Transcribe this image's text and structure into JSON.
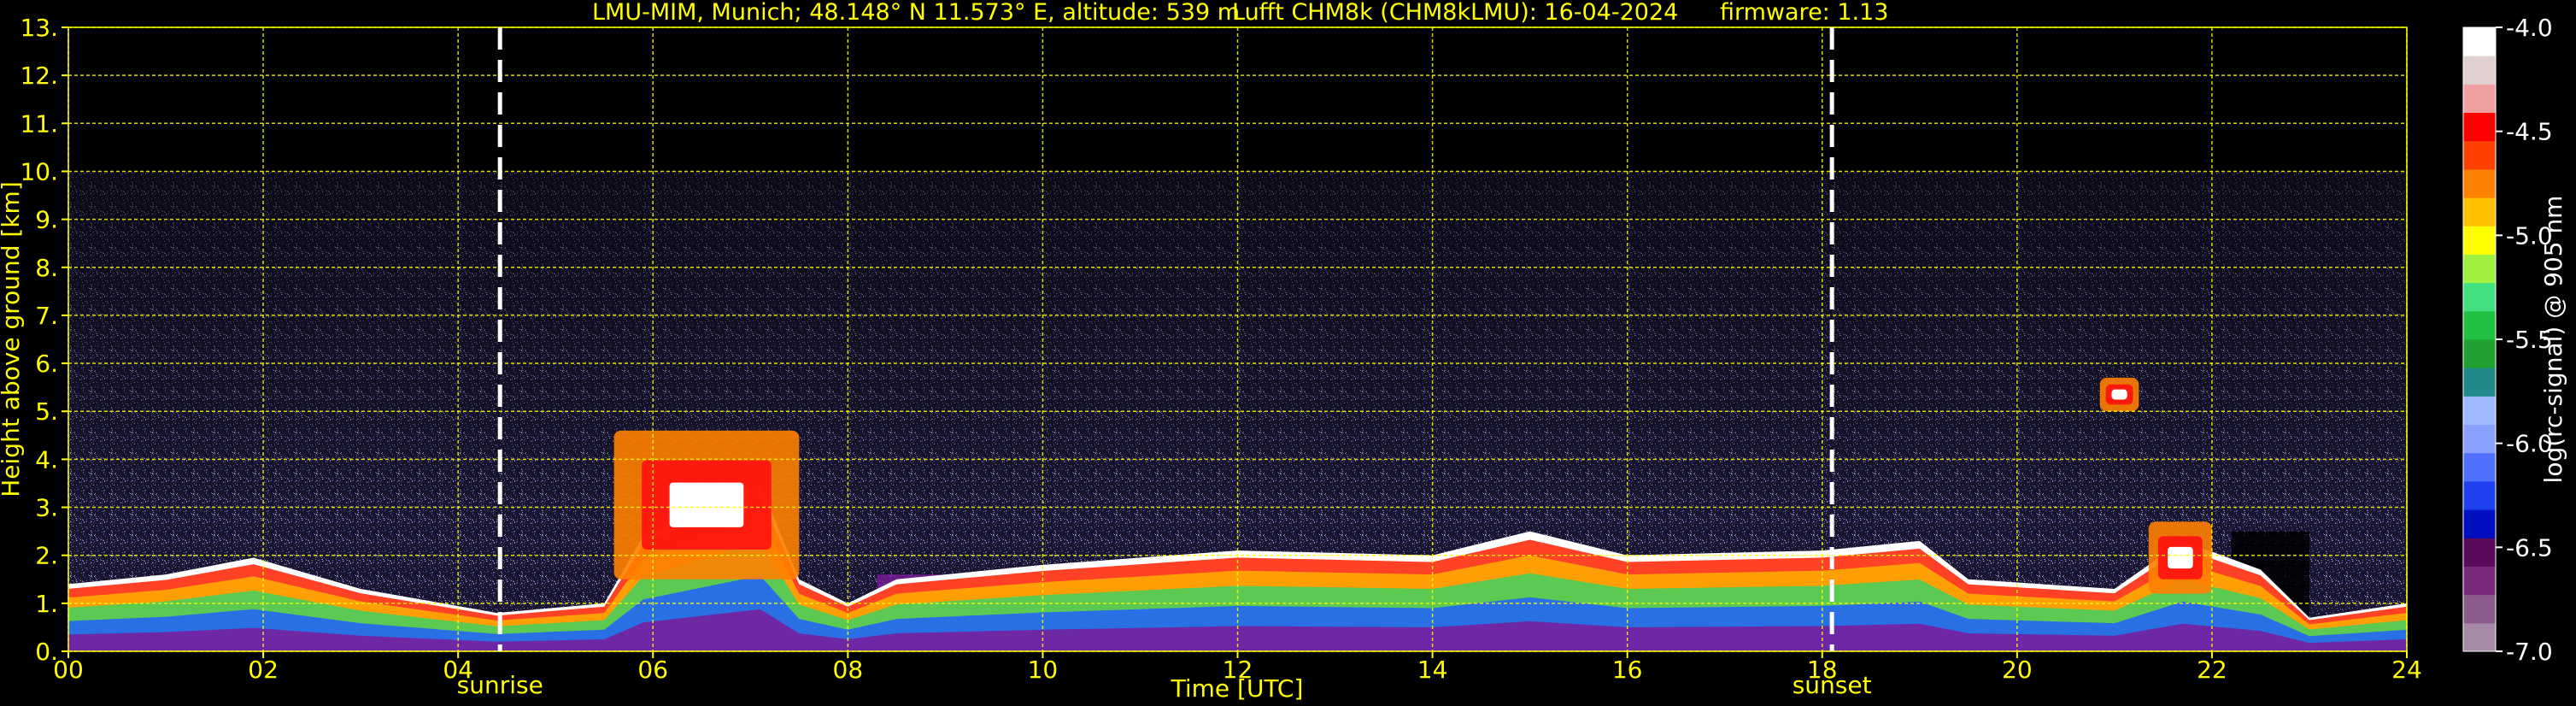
{
  "title": {
    "location": "LMU-MIM, Munich; 48.148° N 11.573° E, altitude: 539 m",
    "instrument": "Lufft CHM8k (CHM8kLMU): 16-04-2024",
    "firmware": "firmware: 1.13"
  },
  "colors": {
    "text": "#ffff00",
    "grid": "#ffff00",
    "background": "#000000",
    "markers": "#ffffff"
  },
  "chart_data": {
    "type": "heatmap",
    "xlabel": "Time [UTC]",
    "ylabel": "Height above ground [km]",
    "xlim": [
      0,
      24
    ],
    "ylim": [
      0,
      13
    ],
    "x_ticks": [
      "00",
      "02",
      "04",
      "06",
      "08",
      "10",
      "12",
      "14",
      "16",
      "18",
      "20",
      "22",
      "24"
    ],
    "y_ticks": [
      "0.",
      "1.",
      "2.",
      "3.",
      "4.",
      "5.",
      "6.",
      "7.",
      "8.",
      "9.",
      "10.",
      "11.",
      "12.",
      "13."
    ],
    "grid": true,
    "data_top_km": 10,
    "colorbar": {
      "label": "log(rc-signal) @ 905 nm",
      "range": [
        -7.0,
        -4.0
      ],
      "ticks": [
        "-4.0",
        "-4.5",
        "-5.0",
        "-5.5",
        "-6.0",
        "-6.5",
        "-7.0"
      ],
      "colors": [
        "#a58aa5",
        "#8a5a8a",
        "#7a2a7a",
        "#5a0a5a",
        "#0010c0",
        "#2040f0",
        "#5070ff",
        "#8aa0ff",
        "#a0b8ff",
        "#208a8a",
        "#20a030",
        "#20c040",
        "#40e080",
        "#a0f040",
        "#ffff00",
        "#ffc000",
        "#ff8000",
        "#ff4000",
        "#ff0000",
        "#f0a0a0",
        "#e0d0d0",
        "#ffffff"
      ]
    },
    "markers": [
      {
        "time_utc": 4.43,
        "label": "sunrise"
      },
      {
        "time_utc": 18.1,
        "label": "sunset"
      }
    ],
    "aerosol_layer_top_km": [
      {
        "t": 0.0,
        "h": 1.4
      },
      {
        "t": 1.0,
        "h": 1.6
      },
      {
        "t": 1.9,
        "h": 1.95
      },
      {
        "t": 3.0,
        "h": 1.3
      },
      {
        "t": 4.4,
        "h": 0.8
      },
      {
        "t": 5.5,
        "h": 1.0
      },
      {
        "t": 5.9,
        "h": 2.4
      },
      {
        "t": 7.1,
        "h": 3.5
      },
      {
        "t": 7.5,
        "h": 1.5
      },
      {
        "t": 8.0,
        "h": 1.0
      },
      {
        "t": 8.5,
        "h": 1.5
      },
      {
        "t": 10.0,
        "h": 1.8
      },
      {
        "t": 12.0,
        "h": 2.1
      },
      {
        "t": 14.0,
        "h": 2.0
      },
      {
        "t": 15.0,
        "h": 2.5
      },
      {
        "t": 16.0,
        "h": 2.0
      },
      {
        "t": 18.0,
        "h": 2.1
      },
      {
        "t": 19.0,
        "h": 2.3
      },
      {
        "t": 19.5,
        "h": 1.5
      },
      {
        "t": 21.0,
        "h": 1.3
      },
      {
        "t": 21.7,
        "h": 2.3
      },
      {
        "t": 22.5,
        "h": 1.7
      },
      {
        "t": 23.0,
        "h": 0.7
      },
      {
        "t": 24.0,
        "h": 1.0
      }
    ],
    "clouds": [
      {
        "t_start": 5.6,
        "t_end": 7.5,
        "h_base": 1.5,
        "h_top": 4.6
      },
      {
        "t_start": 20.85,
        "t_end": 21.25,
        "h_base": 5.0,
        "h_top": 5.7
      },
      {
        "t_start": 21.35,
        "t_end": 22.0,
        "h_base": 1.2,
        "h_top": 2.7
      }
    ]
  }
}
